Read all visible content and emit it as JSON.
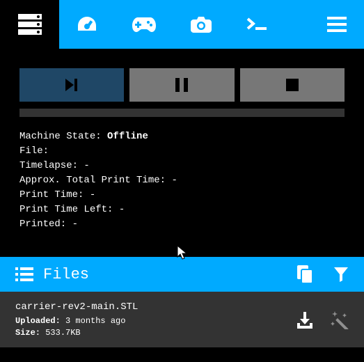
{
  "nav": {
    "logo": "server-icon",
    "items": [
      "dashboard",
      "gamepad",
      "camera",
      "terminal",
      "menu"
    ]
  },
  "status": {
    "machine_state_label": "Machine State: ",
    "machine_state_value": "Offline",
    "file_label": "File:",
    "file_value": "",
    "timelapse_label": "Timelapse: ",
    "timelapse_value": "-",
    "approx_total_label": "Approx. Total Print Time: ",
    "approx_total_value": "-",
    "print_time_label": "Print Time: ",
    "print_time_value": "-",
    "print_time_left_label": "Print Time Left: ",
    "print_time_left_value": "-",
    "printed_label": "Printed: ",
    "printed_value": "-"
  },
  "files": {
    "header_label": "Files",
    "items": [
      {
        "name": "carrier-rev2-main.STL",
        "uploaded_label": "Uploaded: ",
        "uploaded_value": "3 months ago",
        "size_label": "Size: ",
        "size_value": "533.7KB"
      }
    ]
  }
}
